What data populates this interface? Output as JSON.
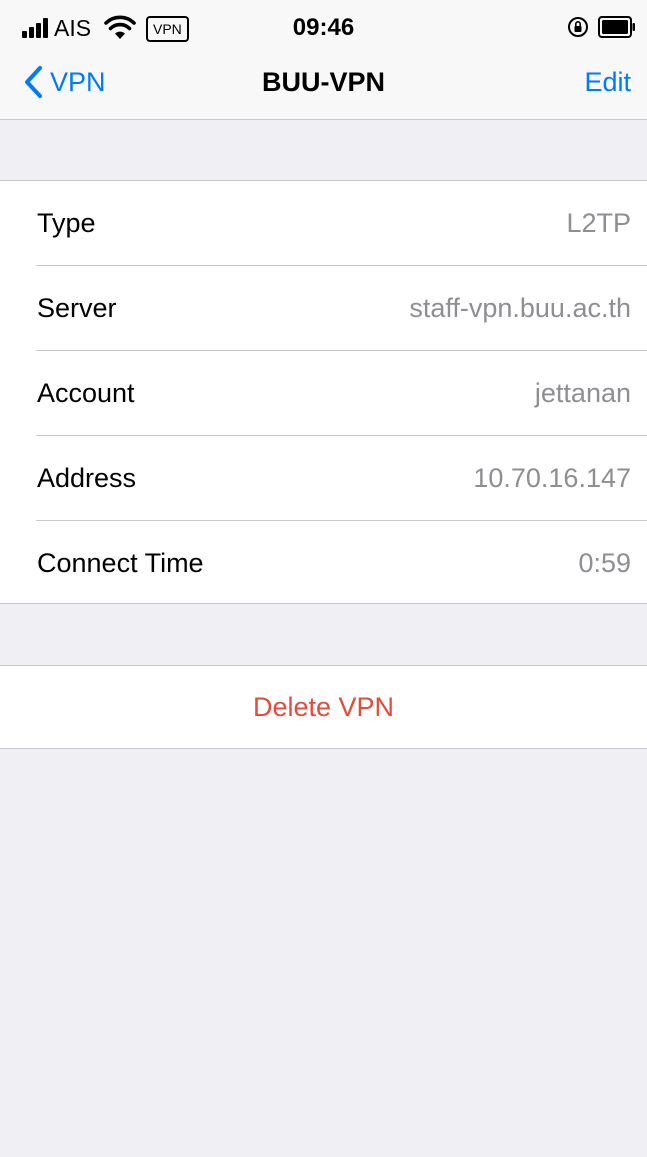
{
  "status_bar": {
    "carrier": "AIS",
    "vpn_badge": "VPN",
    "time": "09:46",
    "icons": [
      "signal-icon",
      "wifi-icon",
      "vpn-badge",
      "rotation-lock-icon",
      "battery-icon"
    ]
  },
  "nav": {
    "back_label": "VPN",
    "title": "BUU-VPN",
    "edit_label": "Edit"
  },
  "details": [
    {
      "label": "Type",
      "value": "L2TP"
    },
    {
      "label": "Server",
      "value": "staff-vpn.buu.ac.th"
    },
    {
      "label": "Account",
      "value": "jettanan"
    },
    {
      "label": "Address",
      "value": "10.70.16.147"
    },
    {
      "label": "Connect Time",
      "value": "0:59"
    }
  ],
  "delete_label": "Delete VPN",
  "colors": {
    "accent": "#007aff",
    "destructive": "#e64a3b",
    "secondary_text": "#8e8e93",
    "grouped_background": "#efeff4"
  }
}
